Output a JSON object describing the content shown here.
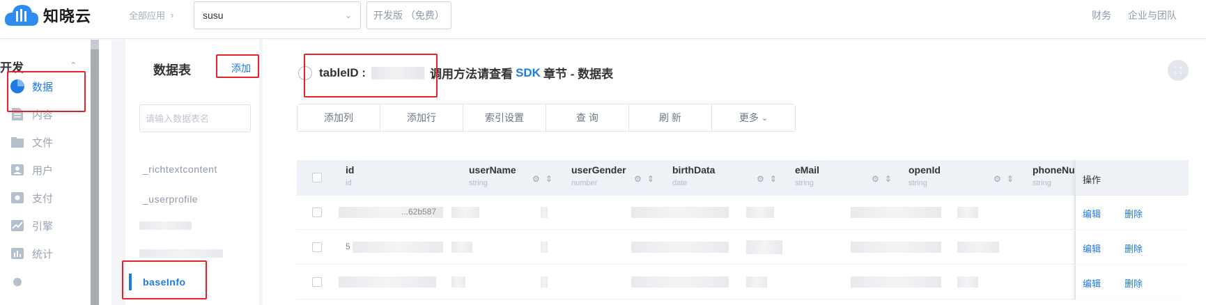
{
  "topbar": {
    "logo_text": "知晓云",
    "breadcrumb": "全部应用",
    "app_selected": "susu",
    "plan": "开发版 （免费）",
    "links": [
      "财务",
      "企业与团队"
    ]
  },
  "sidebar": {
    "section": "开发",
    "items": [
      {
        "label": "数据",
        "icon": "pie-chart-icon",
        "active": true
      },
      {
        "label": "内容",
        "icon": "document-icon",
        "active": false
      },
      {
        "label": "文件",
        "icon": "folder-icon",
        "active": false
      },
      {
        "label": "用户",
        "icon": "user-card-icon",
        "active": false
      },
      {
        "label": "支付",
        "icon": "payment-icon",
        "active": false
      },
      {
        "label": "引擎",
        "icon": "line-chart-icon",
        "active": false
      },
      {
        "label": "统计",
        "icon": "bar-chart-icon",
        "active": false
      }
    ]
  },
  "tables_panel": {
    "title": "数据表",
    "add_label": "添加",
    "search_placeholder": "请输入数据表名",
    "items": [
      {
        "label": "_richtextcontent",
        "active": false
      },
      {
        "label": "_userprofile",
        "active": false
      },
      {
        "label": "baseInfo",
        "active": true
      }
    ]
  },
  "main": {
    "title_prefix": "tableID :",
    "title_text": "调用方法请查看",
    "sdk_link": "SDK",
    "title_suffix": "章节 - 数据表",
    "toolbar": [
      "添加列",
      "添加行",
      "索引设置",
      "查 询",
      "刷 新",
      "更多"
    ],
    "columns": [
      {
        "name": "id",
        "type": "id"
      },
      {
        "name": "userName",
        "type": "string"
      },
      {
        "name": "userGender",
        "type": "number"
      },
      {
        "name": "birthData",
        "type": "date"
      },
      {
        "name": "eMail",
        "type": "string"
      },
      {
        "name": "openId",
        "type": "string"
      },
      {
        "name": "phoneNu",
        "type": "string"
      }
    ],
    "ops_header": "操作",
    "row_actions": {
      "edit": "编辑",
      "delete": "删除"
    },
    "row_fragments": [
      "...62b587",
      "5",
      ""
    ]
  },
  "colors": {
    "accent": "#1d7be5",
    "annotation": "#e8202a"
  }
}
